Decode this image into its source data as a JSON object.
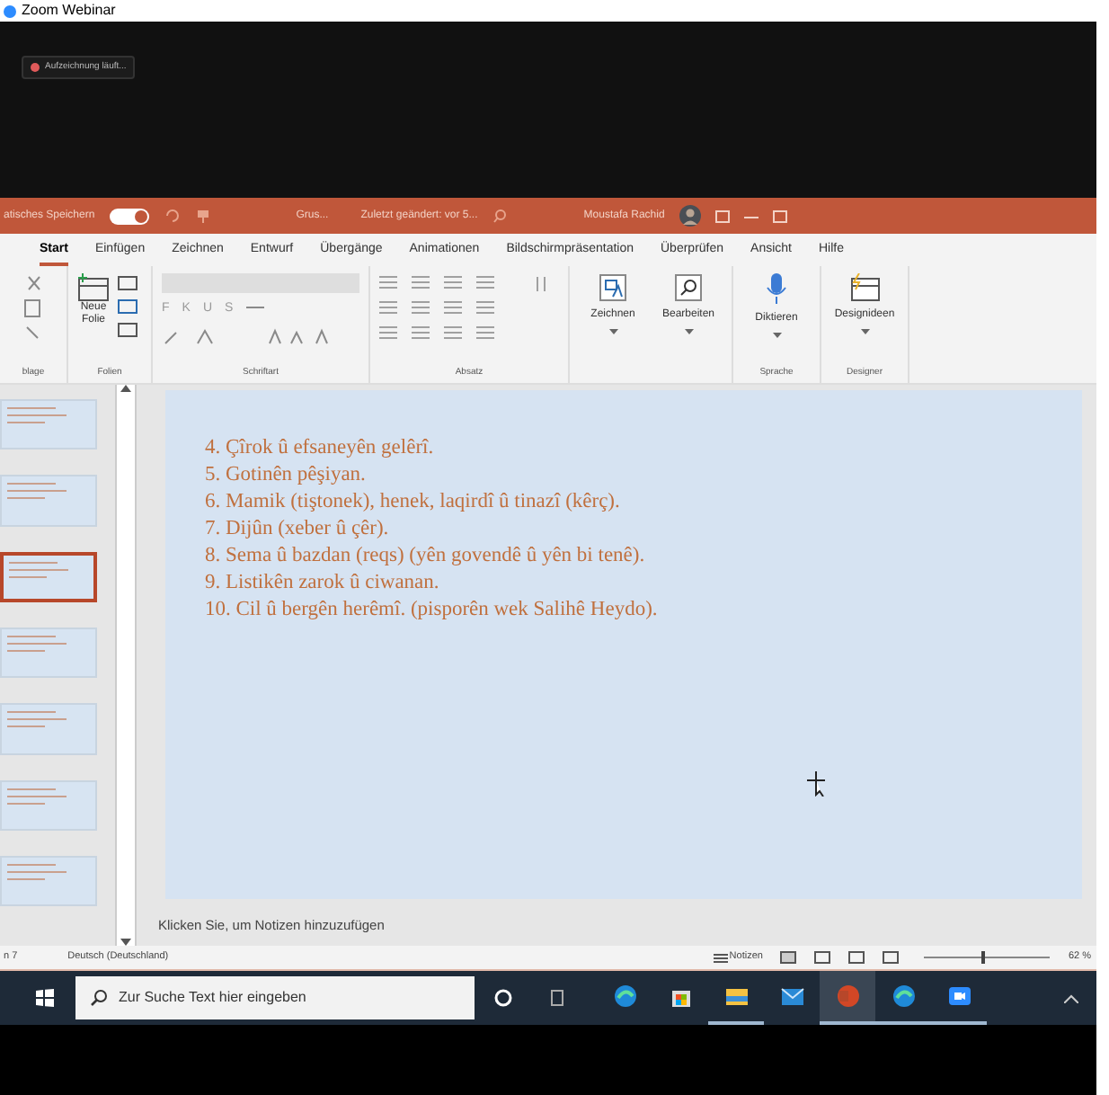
{
  "window": {
    "title": "Zoom Webinar"
  },
  "recording": {
    "label": "Aufzeichnung läuft..."
  },
  "ppt_titlebar": {
    "autosave_label": "atisches Speichern",
    "autosave_on": true,
    "file_name": "Grus...",
    "modified": "Zuletzt geändert: vor 5...",
    "user": "Moustafa Rachid"
  },
  "ribbon_tabs": [
    {
      "label": "Start",
      "selected": true
    },
    {
      "label": "Einfügen",
      "selected": false
    },
    {
      "label": "Zeichnen",
      "selected": false
    },
    {
      "label": "Entwurf",
      "selected": false
    },
    {
      "label": "Übergänge",
      "selected": false
    },
    {
      "label": "Animationen",
      "selected": false
    },
    {
      "label": "Bildschirmpräsentation",
      "selected": false
    },
    {
      "label": "Überprüfen",
      "selected": false
    },
    {
      "label": "Ansicht",
      "selected": false
    },
    {
      "label": "Hilfe",
      "selected": false
    }
  ],
  "ribbon_groups": [
    {
      "kind": "clipboard",
      "label": "blage"
    },
    {
      "kind": "slides",
      "label": "Folien",
      "button": "Neue Folie"
    },
    {
      "kind": "font",
      "label": "Schriftart",
      "letters": [
        "F",
        "K",
        "U",
        "S"
      ]
    },
    {
      "kind": "paragraph",
      "label": "Absatz"
    },
    {
      "kind": "big",
      "buttons": [
        {
          "kind": "draw",
          "label": "Zeichnen"
        },
        {
          "kind": "search",
          "label": "Bearbeiten"
        }
      ]
    },
    {
      "kind": "big",
      "label": "Sprache",
      "buttons": [
        {
          "kind": "mic",
          "label": "Diktieren"
        }
      ]
    },
    {
      "kind": "big",
      "label": "Designer",
      "buttons": [
        {
          "kind": "design",
          "label": "Designideen"
        }
      ]
    }
  ],
  "thumbnails": [
    {
      "selected": false
    },
    {
      "selected": false
    },
    {
      "selected": true
    },
    {
      "selected": false
    },
    {
      "selected": false
    },
    {
      "selected": false
    },
    {
      "selected": false
    }
  ],
  "slide": {
    "lines": [
      "4. Çîrok û efsaneyên gelêrî.",
      "5. Gotinên pêşiyan.",
      "6. Mamik (tiştonek), henek, laqirdî û tinazî (kêrç).",
      "7. Dijûn (xeber û çêr).",
      "8. Sema û bazdan (reqs) (yên govendê û yên bi tenê).",
      "9. Listikên zarok û ciwanan.",
      "10. Cil û bergên herêmî. (pisporên wek Salihê Heydo)."
    ]
  },
  "notes": {
    "placeholder": "Klicken Sie, um Notizen hinzuzufügen"
  },
  "status_bar": {
    "slide_count": "n 7",
    "language": "Deutsch (Deutschland)",
    "notes_button": "Notizen",
    "zoom_slider": {
      "level": 0.45
    },
    "zoom": "62 %"
  },
  "taskbar": {
    "search_placeholder": "Zur Suche Text hier eingeben",
    "apps": [
      {
        "kind": "edge",
        "running": false,
        "selected": false
      },
      {
        "kind": "store",
        "running": false,
        "selected": false
      },
      {
        "kind": "explorer",
        "running": true,
        "selected": false
      },
      {
        "kind": "mail",
        "running": false,
        "selected": false
      },
      {
        "kind": "powerpoint",
        "running": true,
        "selected": true
      },
      {
        "kind": "edge",
        "running": true,
        "selected": false
      },
      {
        "kind": "zoom",
        "running": true,
        "selected": false
      }
    ]
  }
}
